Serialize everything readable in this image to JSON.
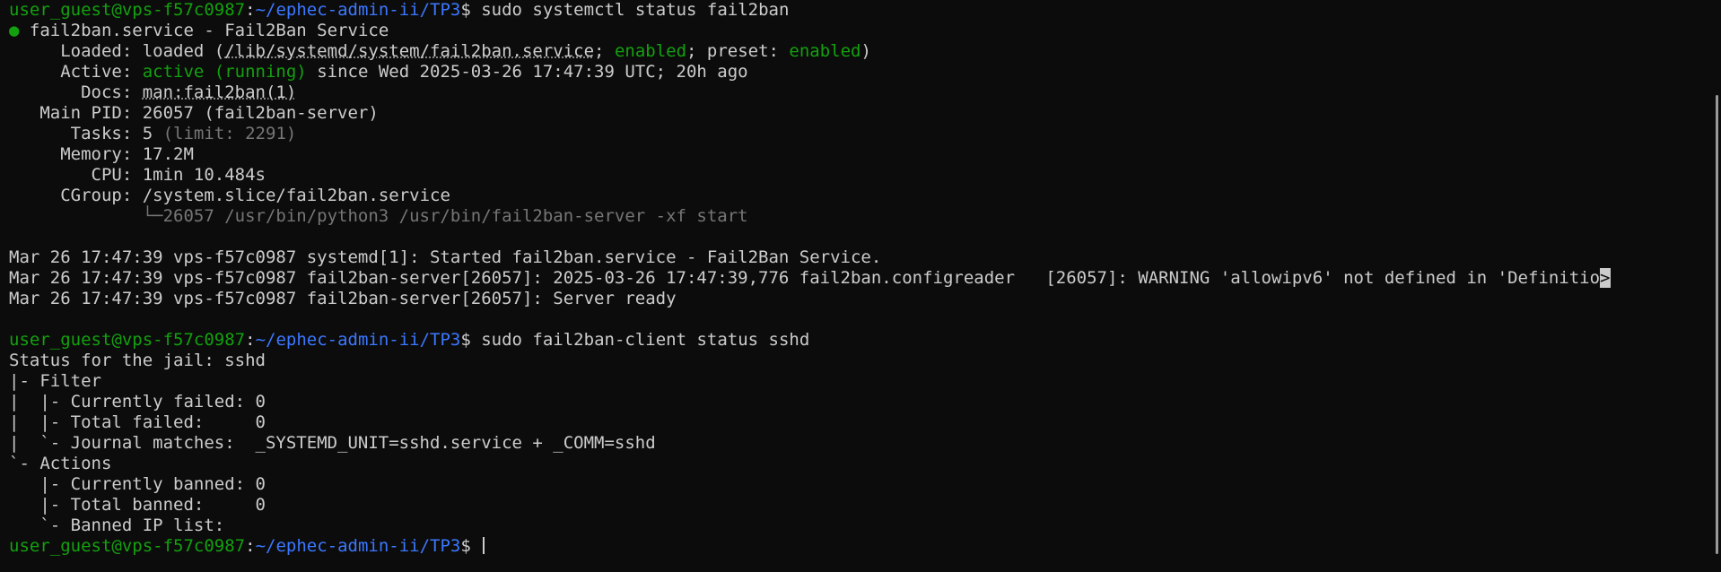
{
  "prompt": {
    "user": "user_guest@vps-f57c0987",
    "colon": ":",
    "path": "~/ephec-admin-ii/TP3",
    "dollar": "$"
  },
  "cmd1": " sudo systemctl status fail2ban",
  "status": {
    "bullet": "●",
    "title": " fail2ban.service - Fail2Ban Service",
    "loaded_label": "     Loaded: ",
    "loaded_pre": "loaded (",
    "loaded_path": "/lib/systemd/system/fail2ban.service",
    "loaded_sep": "; ",
    "loaded_enabled": "enabled",
    "loaded_preset": "; preset: ",
    "loaded_preset_val": "enabled",
    "loaded_close": ")",
    "active_label": "     Active: ",
    "active_state": "active (running)",
    "active_since": " since Wed 2025-03-26 17:47:39 UTC; 20h ago",
    "docs_label": "       Docs: ",
    "docs_val": "man:fail2ban(1)",
    "pid_label": "   Main PID: ",
    "pid_val": "26057 (fail2ban-server)",
    "tasks_label": "      Tasks: ",
    "tasks_val": "5",
    "tasks_limit": " (limit: 2291)",
    "memory_label": "     Memory: ",
    "memory_val": "17.2M",
    "cpu_label": "        CPU: ",
    "cpu_val": "1min 10.484s",
    "cgroup_label": "     CGroup: ",
    "cgroup_val": "/system.slice/fail2ban.service",
    "cgroup_child": "             └─26057 /usr/bin/python3 /usr/bin/fail2ban-server -xf start"
  },
  "logs": [
    "Mar 26 17:47:39 vps-f57c0987 systemd[1]: Started fail2ban.service - Fail2Ban Service.",
    "Mar 26 17:47:39 vps-f57c0987 fail2ban-server[26057]: 2025-03-26 17:47:39,776 fail2ban.configreader   [26057]: WARNING 'allowipv6' not defined in 'Definitio",
    "Mar 26 17:47:39 vps-f57c0987 fail2ban-server[26057]: Server ready"
  ],
  "overflow_char": ">",
  "cmd2": " sudo fail2ban-client status sshd",
  "jail": [
    "Status for the jail: sshd",
    "|- Filter",
    "|  |- Currently failed: 0",
    "|  |- Total failed:     0",
    "|  `- Journal matches:  _SYSTEMD_UNIT=sshd.service + _COMM=sshd",
    "`- Actions",
    "   |- Currently banned: 0",
    "   |- Total banned:     0",
    "   `- Banned IP list:"
  ],
  "final_prompt_trail": " "
}
